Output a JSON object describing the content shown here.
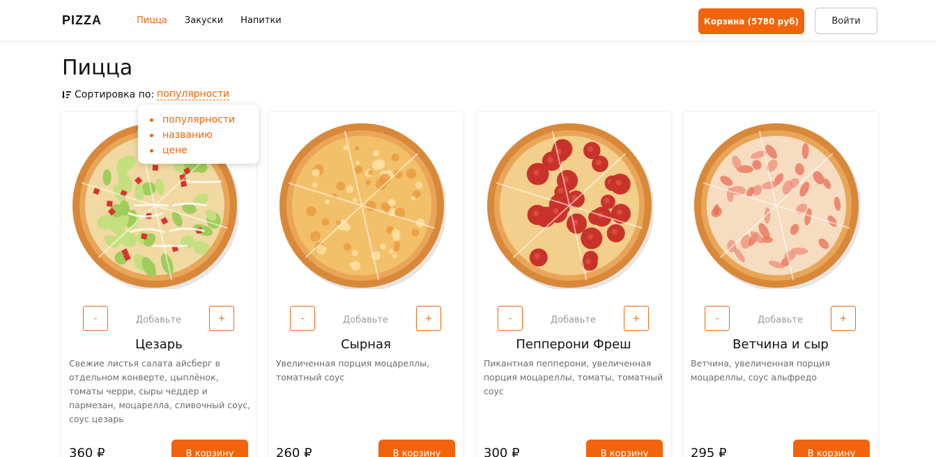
{
  "header": {
    "logo": "PIZZA",
    "nav": [
      {
        "label": "Пицца",
        "active": true
      },
      {
        "label": "Закуски",
        "active": false
      },
      {
        "label": "Напитки",
        "active": false
      }
    ],
    "cart_label": "Корзина (5780 руб)",
    "login_label": "Войти"
  },
  "page": {
    "title": "Пицца",
    "sort_label": "Сортировка по:",
    "sort_value": "популярности"
  },
  "sort_options": [
    "популярности",
    "названию",
    "цене"
  ],
  "products": [
    {
      "name": "Цезарь",
      "description": "Свежие листья салата айсберг в отдельном конверте, цыплёнок, томаты черри, сыры чеддер и пармезан, моцарелла, сливочный соус, соус цезарь",
      "price": "360 ₽",
      "qty_label": "Добавьте",
      "minus": "-",
      "plus": "+",
      "add_label": "В корзину",
      "topping": "caesar"
    },
    {
      "name": "Сырная",
      "description": "Увеличенная порция моцареллы, томатный соус",
      "price": "260 ₽",
      "qty_label": "Добавьте",
      "minus": "-",
      "plus": "+",
      "add_label": "В корзину",
      "topping": "cheese"
    },
    {
      "name": "Пепперони Фреш",
      "description": "Пикантная пепперони, увеличенная порция моцареллы, томаты, томатный соус",
      "price": "300 ₽",
      "qty_label": "Добавьте",
      "minus": "-",
      "plus": "+",
      "add_label": "В корзину",
      "topping": "pepperoni"
    },
    {
      "name": "Ветчина и сыр",
      "description": "Ветчина, увеличенная порция моцареллы, соус альфредо",
      "price": "295 ₽",
      "qty_label": "Добавьте",
      "minus": "-",
      "plus": "+",
      "add_label": "В корзину",
      "topping": "ham"
    }
  ],
  "colors": {
    "accent": "#f2640b",
    "muted_text": "#6b6b6b",
    "border": "#e6e6e6"
  }
}
